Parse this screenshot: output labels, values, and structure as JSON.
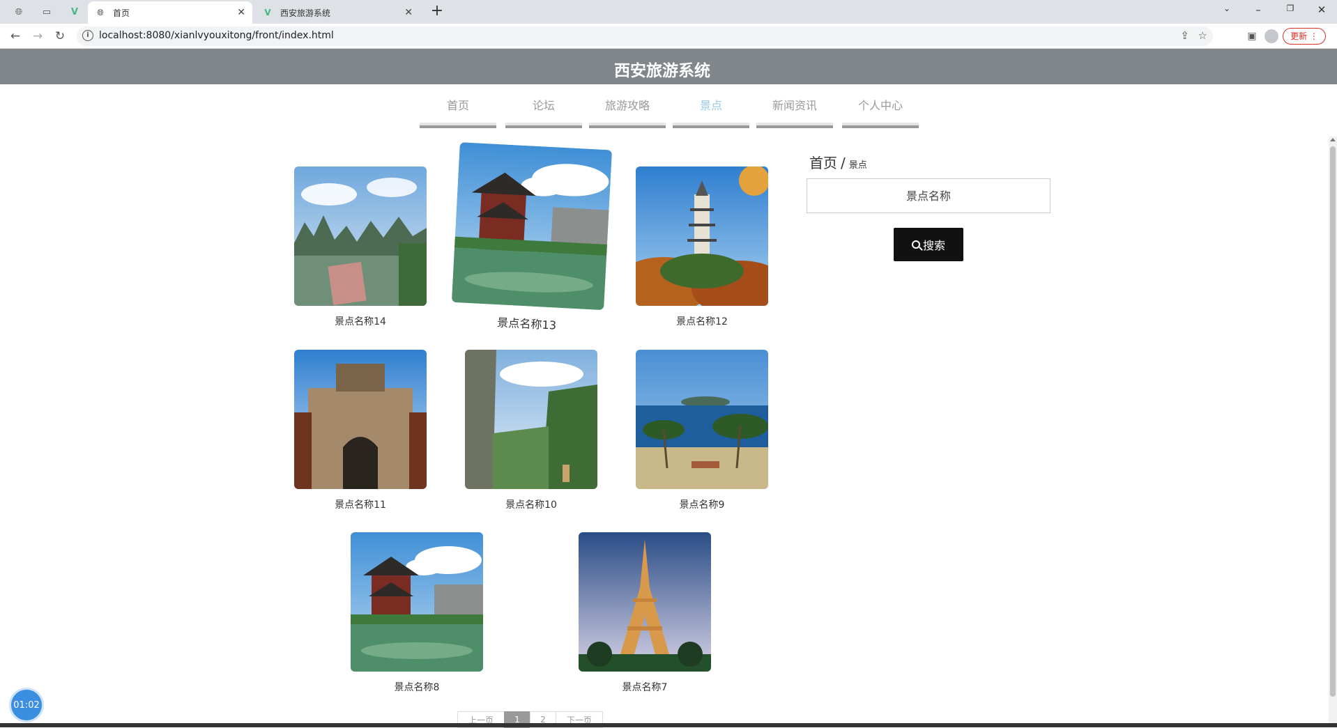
{
  "browser": {
    "tabs": [
      {
        "title": "首页",
        "active": true
      },
      {
        "title": "西安旅游系统",
        "active": false
      }
    ],
    "url": "localhost:8080/xianlvyouxitong/front/index.html",
    "update_label": "更新"
  },
  "site": {
    "title": "西安旅游系统"
  },
  "nav": {
    "items": [
      {
        "label": "首页"
      },
      {
        "label": "论坛"
      },
      {
        "label": "旅游攻略"
      },
      {
        "label": "景点"
      },
      {
        "label": "新闻资讯"
      },
      {
        "label": "个人中心"
      }
    ],
    "active_index": 3
  },
  "cards": [
    {
      "label": "景点名称14",
      "scene": "karst"
    },
    {
      "label": "景点名称13",
      "scene": "pavilion"
    },
    {
      "label": "景点名称12",
      "scene": "pagoda"
    },
    {
      "label": "景点名称11",
      "scene": "gate"
    },
    {
      "label": "景点名称10",
      "scene": "cliff"
    },
    {
      "label": "景点名称9",
      "scene": "beach"
    },
    {
      "label": "景点名称8",
      "scene": "pavilion"
    },
    {
      "label": "景点名称7",
      "scene": "eiffel"
    }
  ],
  "sidebar": {
    "breadcrumb_home": "首页",
    "breadcrumb_sep": "/",
    "breadcrumb_current": "景点",
    "search_placeholder": "景点名称",
    "search_button": "搜索"
  },
  "pager": {
    "prev": "上一页",
    "pages": [
      "1",
      "2"
    ],
    "next": "下一页",
    "current": "1"
  },
  "timer": "01:02"
}
